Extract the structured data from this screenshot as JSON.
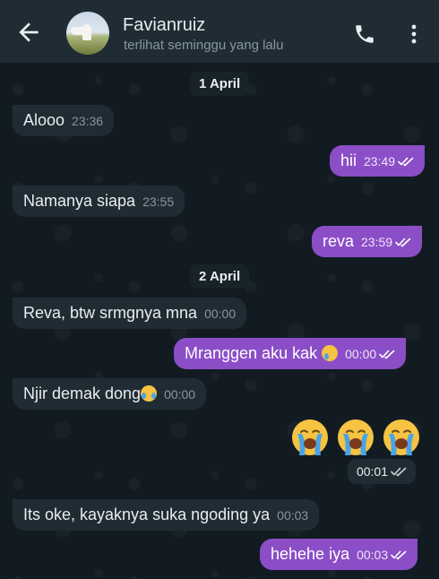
{
  "header": {
    "contact_name": "Favianruiz",
    "contact_status": "terlihat seminggu yang lalu",
    "icons": [
      "back-arrow-icon",
      "phone-icon",
      "more-vertical-icon"
    ]
  },
  "colors": {
    "header_bg": "#1f2c34",
    "chat_bg": "#121b22",
    "incoming_bubble": "#202c33",
    "outgoing_bubble": "#8b4ec7",
    "timestamp": "#8696a0"
  },
  "dates": [
    "1 April",
    "2 April"
  ],
  "messages": [
    {
      "direction": "incoming",
      "text": "Alooo",
      "time": "23:36"
    },
    {
      "direction": "outgoing",
      "text": "hii",
      "time": "23:49",
      "status": "read"
    },
    {
      "direction": "incoming",
      "text": "Namanya siapa",
      "time": "23:55"
    },
    {
      "direction": "outgoing",
      "text": "reva",
      "time": "23:59",
      "status": "read"
    },
    {
      "direction": "incoming",
      "text": "Reva, btw srmgnya mna",
      "time": "00:00"
    },
    {
      "direction": "outgoing",
      "text": "Mranggen aku kak",
      "emoji": "crying-face-emoji",
      "time": "00:00",
      "status": "read"
    },
    {
      "direction": "incoming",
      "text": "Njir demak dong",
      "emoji": "loudly-crying-face-emoji",
      "time": "00:00"
    },
    {
      "direction": "outgoing",
      "emojis": [
        "loudly-crying-face-emoji",
        "loudly-crying-face-emoji",
        "loudly-crying-face-emoji"
      ],
      "time": "00:01",
      "status": "read"
    },
    {
      "direction": "incoming",
      "text": "Its oke, kayaknya suka ngoding ya",
      "time": "00:03"
    },
    {
      "direction": "outgoing",
      "text": "hehehe iya",
      "time": "00:03",
      "status": "read"
    }
  ]
}
